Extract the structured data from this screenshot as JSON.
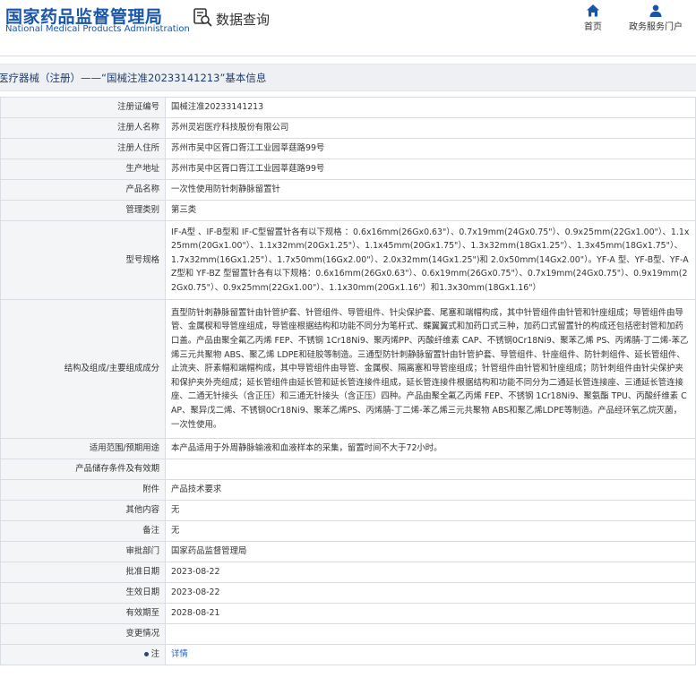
{
  "header": {
    "logo_cn": "国家药品监督管理局",
    "logo_en": "National Medical Products Administration",
    "query_label": "数据查询",
    "nav": [
      {
        "label": "首页",
        "icon": "home-icon"
      },
      {
        "label": "政务服务门户",
        "icon": "user-icon"
      }
    ]
  },
  "title_bar": {
    "text": "医疗器械（注册）——“国械注准20233141213”基本信息"
  },
  "rows": [
    {
      "label": "注册证编号",
      "value": "国械注准20233141213"
    },
    {
      "label": "注册人名称",
      "value": "苏州灵岩医疗科技股份有限公司"
    },
    {
      "label": "注册人住所",
      "value": "苏州市吴中区胥口胥江工业园莘莛路99号"
    },
    {
      "label": "生产地址",
      "value": "苏州市吴中区胥口胥江工业园莘莛路99号"
    },
    {
      "label": "产品名称",
      "value": "一次性使用防针刺静脉留置针"
    },
    {
      "label": "管理类别",
      "value": "第三类"
    },
    {
      "label": "型号规格",
      "value": "IF-A型 、IF-B型和 IF-C型留置针各有以下规格 ：0.6x16mm(26Gx0.63\"）、0.7x19mm(24Gx0.75\"）、0.9x25mm(22Gx1.00\"）、1.1x25mm(20Gx1.00\"）、1.1x32mm(20Gx1.25\"）、1.1x45mm(20Gx1.75\"）、1.3x32mm(18Gx1.25\"）、1.3x45mm(18Gx1.75\"）、1.7x32mm(16Gx1.25\"）、1.7x50mm(16Gx2.00\"）、2.0x32mm(14Gx1.25\")和 2.0x50mm(14Gx2.00\"）。YF-A 型、YF-B型、YF-AZ型和 YF-BZ 型留置针各有以下规格：0.6x16mm(26Gx0.63\"）、0.6x19mm(26Gx0.75\"）、0.7x19mm(24Gx0.75\"）、0.9x19mm(22Gx0.75\"）、0.9x25mm(22Gx1.00\"）、1.1x30mm(20Gx1.16\"）和1.3x30mm(18Gx1.16\"）"
    },
    {
      "label": "结构及组成/主要组成成分",
      "value": "直型防针刺静脉留置针由针管护套、针管组件、导管组件、针尖保护套、尾塞和端帽构成，其中针管组件由针管和针座组成；导管组件由导管、金属楔和导管座组成，导管座根据结构和功能不同分为笔杆式、蝶翼翼式和加药口式三种，加药口式留置针的构成还包括密封管和加药口盖。产品由聚全氟乙丙烯 FEP、不锈钢 1Cr18Ni9、聚丙烯PP、丙酸纤维素 CAP、不锈钢0Cr18Ni9、聚苯乙烯 PS、丙烯腈-丁二烯-苯乙烯三元共聚物 ABS、聚乙烯 LDPE和硅胶等制造。三通型防针刺静脉留置针由针管护套、导管组件、针座组件、防针刺组件、延长管组件、止流夹、肝素帽和端帽构成，其中导管组件由导管、金属楔、隔离塞和导管座组成；针管组件由针管和针座组成；防针刺组件由针尖保护夹和保护夹外壳组成；延长管组件由延长管和延长管连接件组成，延长管连接件根据结构和功能不同分为二通延长管连接座、三通延长管连接座、二通无针接头（含正压）和三通无针接头（含正压）四种。产品由聚全氟乙丙烯 FEP、不锈钢 1Cr18Ni9、聚氨酯 TPU、丙酸纤维素 CAP、聚异戊二烯、不锈钢0Cr18Ni9、聚苯乙烯PS、丙烯腈-丁二烯-苯乙烯三元共聚物 ABS和聚乙烯LDPE等制造。产品经环氧乙烷灭菌，一次性使用。"
    },
    {
      "label": "适用范围/预期用途",
      "value": "本产品适用于外周静脉输液和血液样本的采集，留置时间不大于72小时。"
    },
    {
      "label": "产品储存条件及有效期",
      "value": ""
    },
    {
      "label": "附件",
      "value": "产品技术要求"
    },
    {
      "label": "其他内容",
      "value": "无"
    },
    {
      "label": "备注",
      "value": "无"
    },
    {
      "label": "审批部门",
      "value": "国家药品监督管理局"
    },
    {
      "label": "批准日期",
      "value": "2023-08-22"
    },
    {
      "label": "生效日期",
      "value": "2023-08-22"
    },
    {
      "label": "有效期至",
      "value": "2028-08-21"
    },
    {
      "label": "变更情况",
      "value": ""
    },
    {
      "label": "注",
      "value": "详情"
    }
  ]
}
